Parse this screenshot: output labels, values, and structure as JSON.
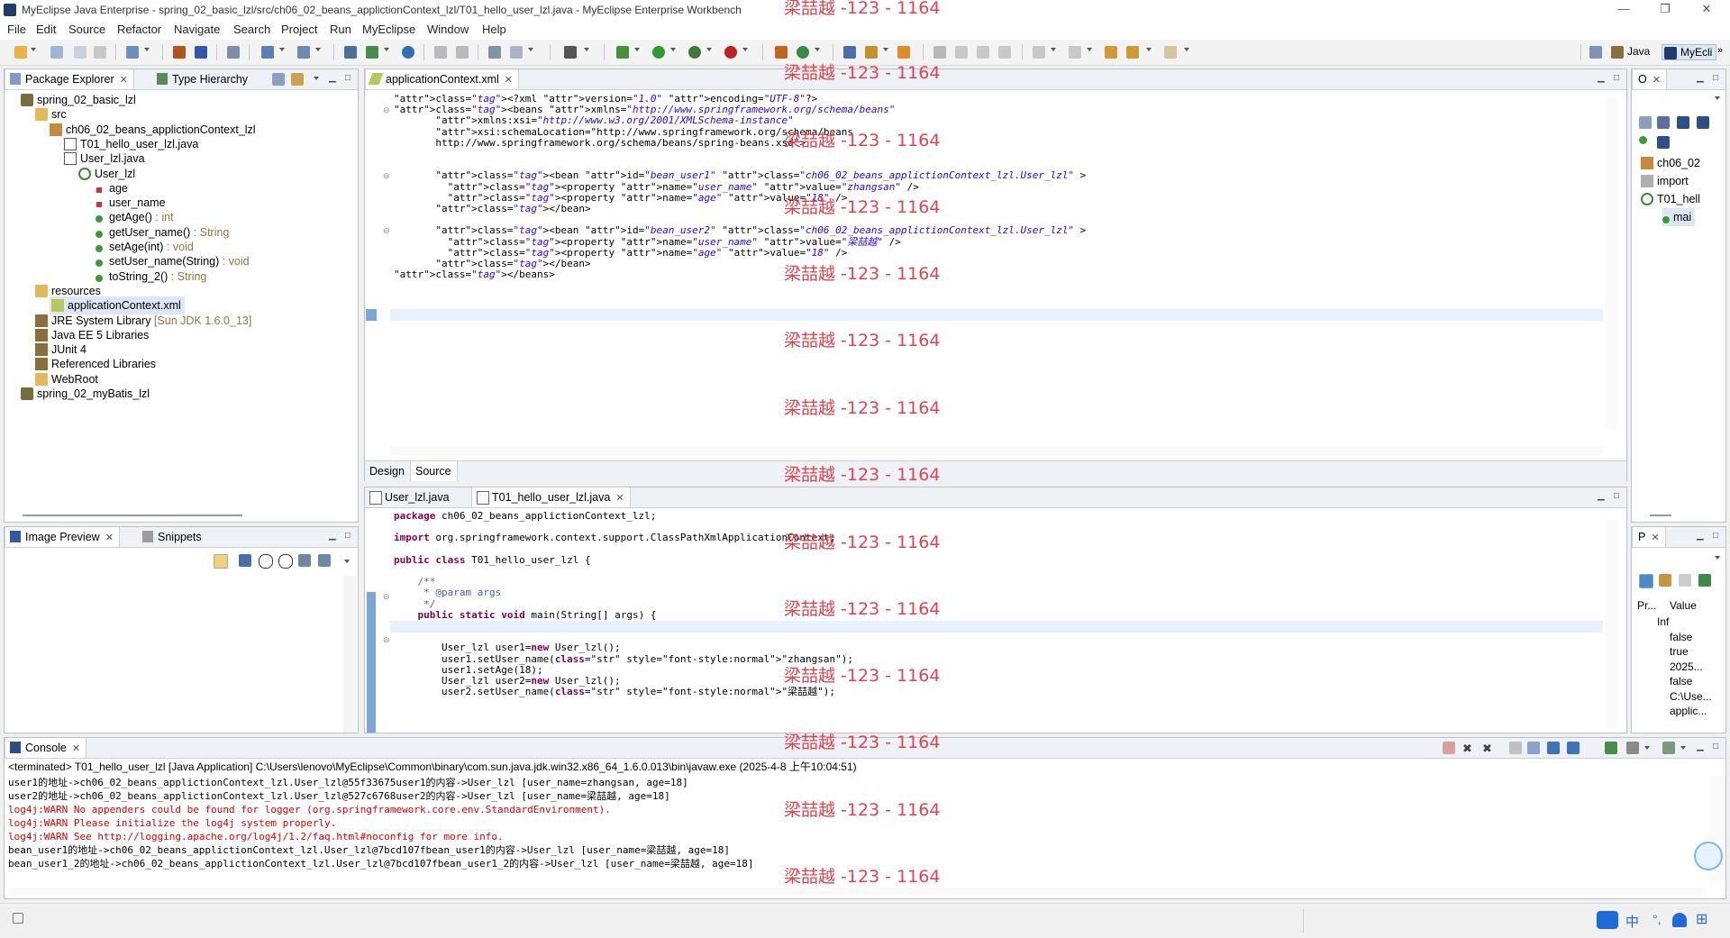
{
  "window": {
    "title": "MyEclipse Java Enterprise - spring_02_basic_lzl/src/ch06_02_beans_applictionContext_lzl/T01_hello_user_lzl.java - MyEclipse Enterprise Workbench",
    "minimize": "—",
    "restore": "❐",
    "close": "✕"
  },
  "menu": [
    "File",
    "Edit",
    "Source",
    "Refactor",
    "Navigate",
    "Search",
    "Project",
    "Run",
    "MyEclipse",
    "Window",
    "Help"
  ],
  "perspectives": {
    "java": "Java",
    "myeclipse": "MyEcli",
    "more": "»"
  },
  "package_explorer": {
    "tabs": [
      "Package Explorer",
      "Type Hierarchy"
    ],
    "tree": [
      {
        "label": "spring_02_basic_lzl",
        "icon": "project-icon",
        "level": 0
      },
      {
        "label": "src",
        "icon": "folder-icon",
        "level": 1
      },
      {
        "label": "ch06_02_beans_applictionContext_lzl",
        "icon": "package-icon",
        "level": 2
      },
      {
        "label": "T01_hello_user_lzl.java",
        "icon": "java-file-icon",
        "level": 3
      },
      {
        "label": "User_lzl.java",
        "icon": "java-file-icon",
        "level": 3
      },
      {
        "label": "User_lzl",
        "icon": "class-icon",
        "level": 4
      },
      {
        "label": "age",
        "icon": "private-field-icon",
        "level": 5,
        "ret": ""
      },
      {
        "label": "user_name",
        "icon": "private-field-icon",
        "level": 5,
        "ret": ""
      },
      {
        "label": "getAge()",
        "icon": "public-method-icon",
        "level": 5,
        "ret": " : int"
      },
      {
        "label": "getUser_name()",
        "icon": "public-method-icon",
        "level": 5,
        "ret": " : String"
      },
      {
        "label": "setAge(int)",
        "icon": "public-method-icon",
        "level": 5,
        "ret": " : void"
      },
      {
        "label": "setUser_name(String)",
        "icon": "public-method-icon",
        "level": 5,
        "ret": " : void"
      },
      {
        "label": "toString_2()",
        "icon": "public-method-icon",
        "level": 5,
        "ret": " : String"
      },
      {
        "label": "resources",
        "icon": "folder-icon",
        "level": 1
      },
      {
        "label": "applicationContext.xml",
        "icon": "xml-file-icon",
        "level": 2,
        "selected": true
      },
      {
        "label": "JRE System Library",
        "icon": "library-icon",
        "level": 1,
        "ret": " [Sun JDK 1.6.0_13]"
      },
      {
        "label": "Java EE 5 Libraries",
        "icon": "library-icon",
        "level": 1
      },
      {
        "label": "JUnit 4",
        "icon": "library-icon",
        "level": 1
      },
      {
        "label": "Referenced Libraries",
        "icon": "library-icon",
        "level": 1
      },
      {
        "label": "WebRoot",
        "icon": "folder-icon",
        "level": 1
      },
      {
        "label": "spring_02_myBatis_lzl",
        "icon": "project-icon",
        "level": 0
      }
    ]
  },
  "image_preview": {
    "tabs": [
      "Image Preview",
      "Snippets"
    ]
  },
  "xml_editor": {
    "tab": "applicationContext.xml",
    "bottom_tabs": [
      "Design",
      "Source"
    ],
    "lines": [
      "<?xml version=\"1.0\" encoding=\"UTF-8\"?>",
      "<beans xmlns=\"http://www.springframework.org/schema/beans\"",
      "       xmlns:xsi=\"http://www.w3.org/2001/XMLSchema-instance\"",
      "       xsi:schemaLocation=\"http://www.springframework.org/schema/beans",
      "       http://www.springframework.org/schema/beans/spring-beans.xsd\">",
      "",
      "",
      "       <bean id=\"bean_user1\" class=\"ch06_02_beans_applictionContext_lzl.User_lzl\" >",
      "         <property name=\"user_name\" value=\"zhangsan\" />",
      "         <property name=\"age\" value=\"18\" />",
      "       </bean>",
      "",
      "       <bean id=\"bean_user2\" class=\"ch06_02_beans_applictionContext_lzl.User_lzl\" >",
      "         <property name=\"user_name\" value=\"梁喆越\" />",
      "         <property name=\"age\" value=\"18\" />",
      "       </bean>",
      "</beans>"
    ]
  },
  "java_editor": {
    "tabs": [
      "User_lzl.java",
      "T01_hello_user_lzl.java"
    ],
    "lines": [
      "package ch06_02_beans_applictionContext_lzl;",
      "",
      "import org.springframework.context.support.ClassPathXmlApplicationContext;",
      "",
      "public class T01_hello_user_lzl {",
      "",
      "    /**",
      "     * @param args",
      "     */",
      "    public static void main(String[] args) {",
      "",
      "",
      "        User_lzl user1=new User_lzl();",
      "        user1.setUser_name(\"zhangsan\");",
      "        user1.setAge(18);",
      "        User_lzl user2=new User_lzl();",
      "        user2.setUser_name(\"梁喆越\");"
    ]
  },
  "outline": {
    "tab": "O",
    "items": [
      "ch06_02",
      "import",
      "T01_hell",
      "mai"
    ]
  },
  "properties": {
    "tab": "P",
    "headers": [
      "Pr...",
      "Value"
    ],
    "rows": [
      {
        "prop": "Inf",
        "value": ""
      },
      {
        "prop": "",
        "value": "false"
      },
      {
        "prop": "",
        "value": "true"
      },
      {
        "prop": "",
        "value": "2025..."
      },
      {
        "prop": "",
        "value": "false"
      },
      {
        "prop": "",
        "value": "C:\\Use..."
      },
      {
        "prop": "",
        "value": "applic..."
      }
    ]
  },
  "console": {
    "tab": "Console",
    "header": "<terminated> T01_hello_user_lzl [Java Application] C:\\Users\\lenovo\\MyEclipse\\Common\\binary\\com.sun.java.jdk.win32.x86_64_1.6.0.013\\bin\\javaw.exe (2025-4-8 上午10:04:51)",
    "lines": [
      {
        "text": "user1的地址->ch06_02_beans_applictionContext_lzl.User_lzl@55f33675user1的内容->User_lzl [user_name=zhangsan, age=18]",
        "color": "black"
      },
      {
        "text": "user2的地址->ch06_02_beans_applictionContext_lzl.User_lzl@527c6768user2的内容->User_lzl [user_name=梁喆越, age=18]",
        "color": "black"
      },
      {
        "text": "log4j:WARN No appenders could be found for logger (org.springframework.core.env.StandardEnvironment).",
        "color": "red"
      },
      {
        "text": "log4j:WARN Please initialize the log4j system properly.",
        "color": "red"
      },
      {
        "text": "log4j:WARN See http://logging.apache.org/log4j/1.2/faq.html#noconfig for more info.",
        "color": "red"
      },
      {
        "text": "bean_user1的地址->ch06_02_beans_applictionContext_lzl.User_lzl@7bcd107fbean_user1的内容->User_lzl [user_name=梁喆越, age=18]",
        "color": "black"
      },
      {
        "text": "bean_user1_2的地址->ch06_02_beans_applictionContext_lzl.User_lzl@7bcd107fbean_user1_2的内容->User_lzl [user_name=梁喆越, age=18]",
        "color": "black"
      }
    ]
  },
  "watermark": "梁喆越 -123 - 1164",
  "taskbar": {
    "ime": "中",
    "items": [
      "°,",
      "⊞"
    ]
  },
  "colors": {
    "accent": "#3f7fbf",
    "warn": "#d00000",
    "keyword": "#7f0055",
    "string": "#2a00ff"
  }
}
